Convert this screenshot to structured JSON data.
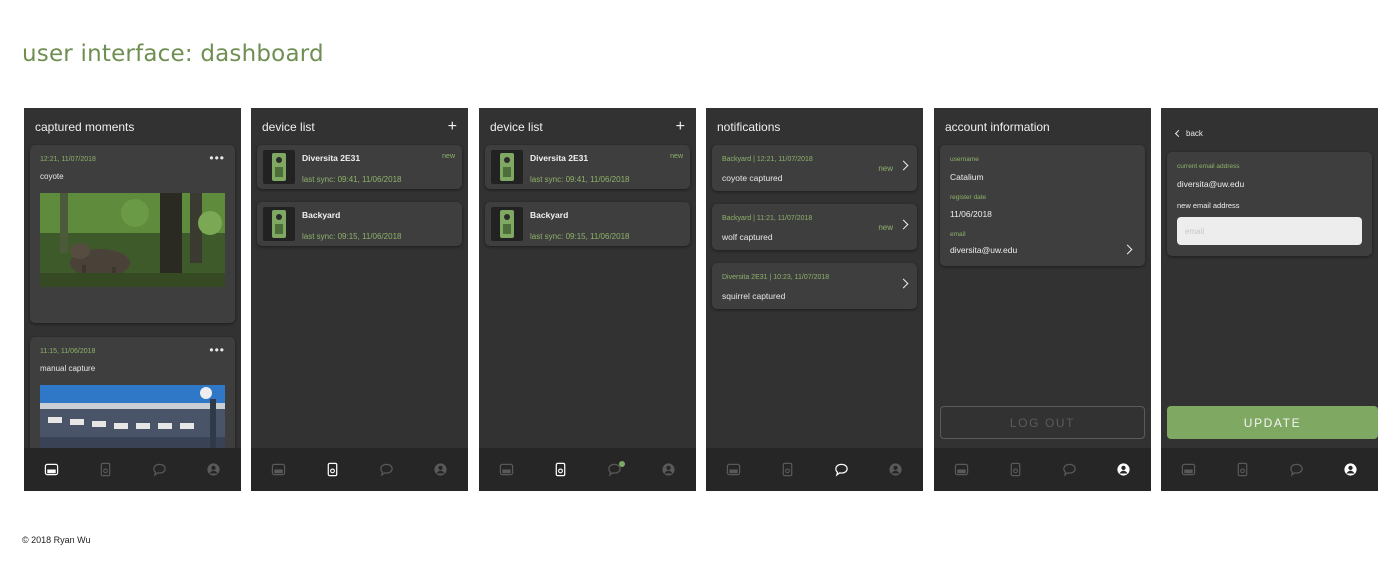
{
  "page": {
    "heading": "user interface: dashboard",
    "footer": "© 2018 Ryan Wu"
  },
  "colors": {
    "accent": "#7fa863",
    "screen_bg": "#323232",
    "card_bg": "#3e3e3e",
    "nav_bg": "#262626",
    "heading": "#6f8f52"
  },
  "nav_icons": [
    "moments-icon",
    "device-icon",
    "chat-bubble-icon",
    "user-icon"
  ],
  "moments_screen": {
    "title": "captured moments",
    "more_label": "•••",
    "items": [
      {
        "meta": "12:21, 11/07/2018",
        "title": "coyote",
        "photo": "coyote-photo"
      },
      {
        "meta": "11:15, 11/06/2018",
        "title": "manual capture",
        "photo": "building-photo"
      }
    ]
  },
  "device_list": {
    "title": "device list",
    "add_label": "+",
    "devices": [
      {
        "name": "Diversita 2E31",
        "badge": "new",
        "sync": "last sync: 09:41, 11/06/2018"
      },
      {
        "name": "Backyard",
        "badge": "",
        "sync": "last sync: 09:15, 11/06/2018"
      }
    ]
  },
  "notifications": {
    "title": "notifications",
    "items": [
      {
        "meta": "Backyard | 12:21, 11/07/2018",
        "title": "coyote captured",
        "badge": "new"
      },
      {
        "meta": "Backyard | 11:21, 11/07/2018",
        "title": "wolf captured",
        "badge": "new"
      },
      {
        "meta": "Diversita 2E31 | 10:23, 11/07/2018",
        "title": "squirrel captured",
        "badge": ""
      }
    ]
  },
  "account": {
    "title": "account information",
    "username_label": "username",
    "username": "Catalium",
    "register_label": "register date",
    "register_date": "11/06/2018",
    "email_label": "email",
    "email": "diversita@uw.edu",
    "logout": "LOG OUT"
  },
  "email_edit": {
    "back": "back",
    "current_label": "current email address",
    "current_email": "diversita@uw.edu",
    "new_label": "new email address",
    "new_placeholder": "email",
    "update": "UPDATE"
  },
  "screens_active_tab": [
    0,
    1,
    1,
    2,
    3,
    3
  ]
}
